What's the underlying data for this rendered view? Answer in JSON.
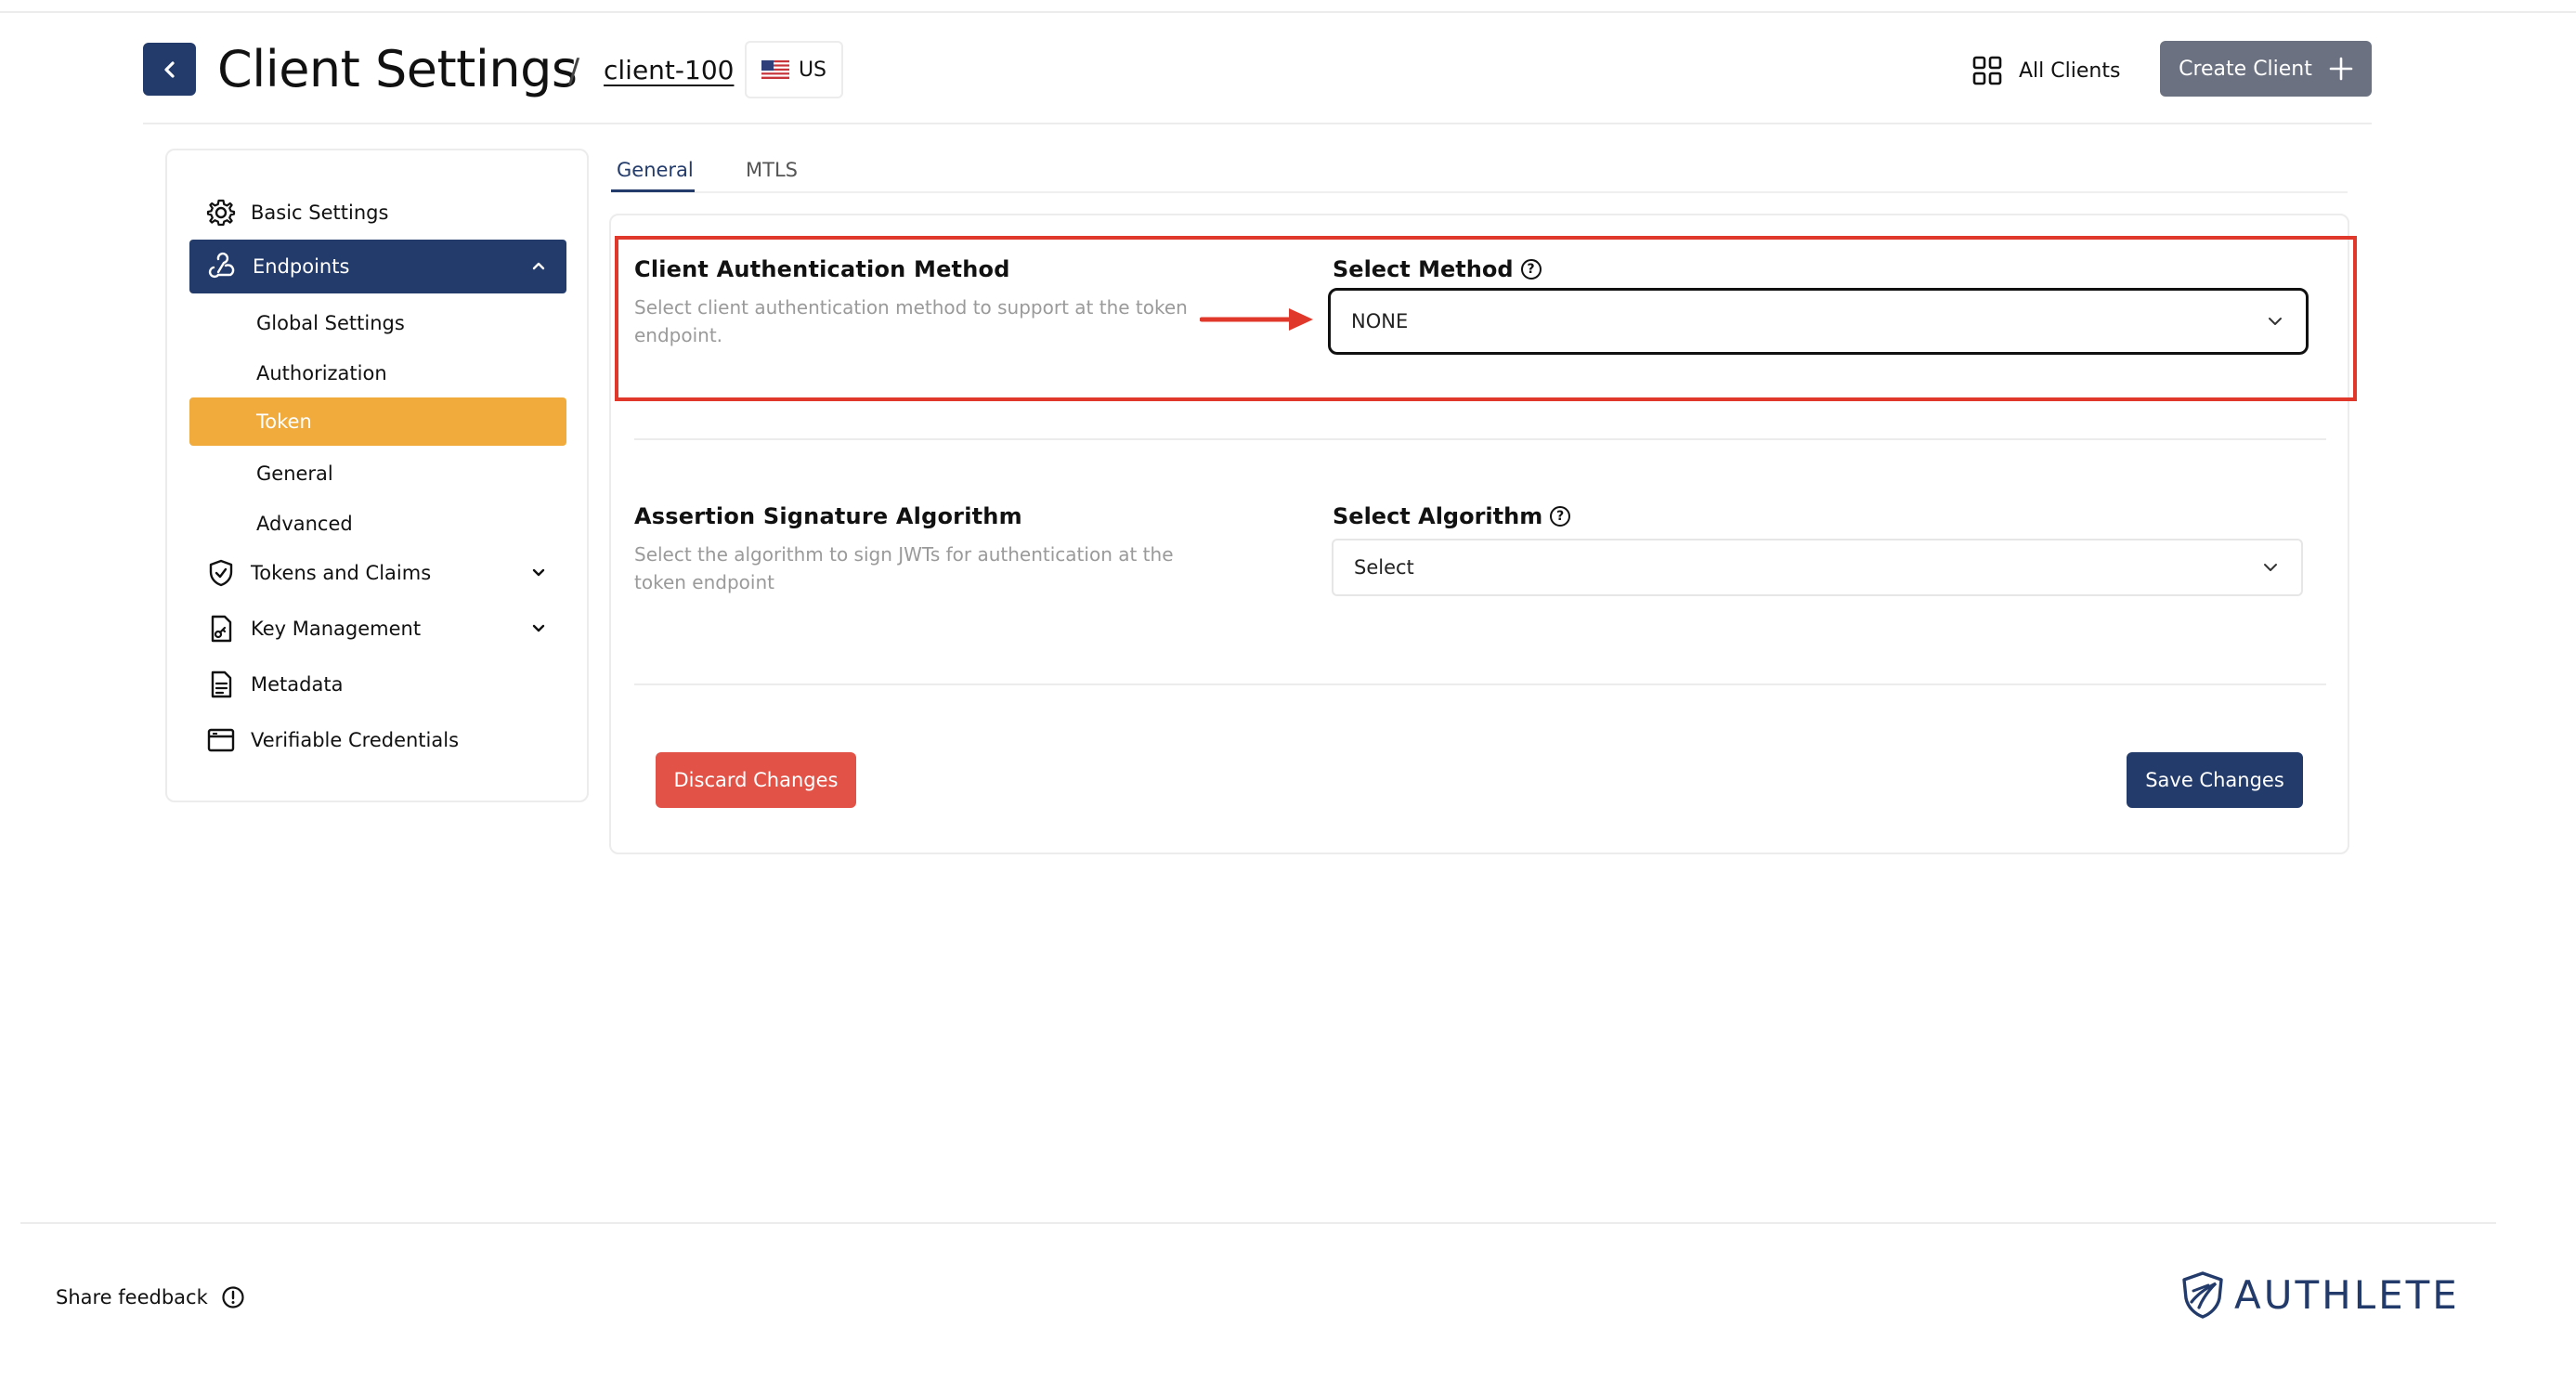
{
  "header": {
    "title": "Client Settings",
    "separator": "/",
    "client_id": "client-100",
    "region": "US",
    "all_clients_label": "All Clients",
    "create_client_label": "Create Client"
  },
  "sidebar": {
    "basic_settings": "Basic Settings",
    "endpoints": "Endpoints",
    "endpoint_items": [
      "Global Settings",
      "Authorization",
      "Token",
      "General",
      "Advanced"
    ],
    "tokens_and_claims": "Tokens and Claims",
    "key_management": "Key Management",
    "metadata": "Metadata",
    "verifiable_credentials": "Verifiable Credentials",
    "selected_item": "Token"
  },
  "tabs": [
    {
      "label": "General",
      "active": true
    },
    {
      "label": "MTLS",
      "active": false
    }
  ],
  "auth_method": {
    "title": "Client Authentication Method",
    "description": "Select client authentication method to support at the token endpoint.",
    "field_label": "Select Method",
    "value": "NONE"
  },
  "assertion_algorithm": {
    "title": "Assertion Signature Algorithm",
    "description": "Select the algorithm to sign JWTs for authentication at the token endpoint",
    "field_label": "Select Algorithm",
    "value": "Select"
  },
  "actions": {
    "discard_label": "Discard Changes",
    "save_label": "Save Changes"
  },
  "footer": {
    "feedback_label": "Share feedback",
    "brand": "AUTHLETE"
  },
  "colors": {
    "primary": "#233b6b",
    "accent": "#f0ab3c",
    "danger": "#e25247",
    "highlight": "#e0392b",
    "muted_button": "#6b7180"
  }
}
